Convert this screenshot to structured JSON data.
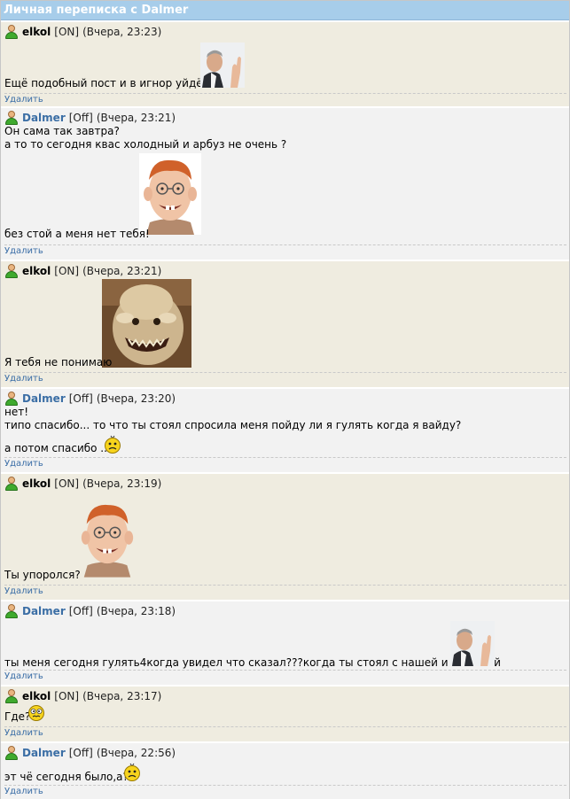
{
  "header": {
    "title": "Личная переписка с Dalmer"
  },
  "delete_label": "Удалить",
  "messages": [
    {
      "author": "elkol",
      "status": "[ON]",
      "time": "(Вчера, 23:23)",
      "lines": [
        "Ещё подобный пост и в игнор уйдёшь"
      ],
      "image": "politician-pointing-photo"
    },
    {
      "author": "Dalmer",
      "status": "[Off]",
      "time": "(Вчера, 23:21)",
      "lines": [
        "Он сама так завтра?",
        "а то то сегодня квас холодный и арбуз не очень ?",
        "без стой а меня нет тебя!"
      ],
      "image": "redhead-boy-caricature"
    },
    {
      "author": "elkol",
      "status": "[ON]",
      "time": "(Вчера, 23:21)",
      "lines": [
        "Я тебя не понимаю"
      ],
      "image": "furry-creature-photo"
    },
    {
      "author": "Dalmer",
      "status": "[Off]",
      "time": "(Вчера, 23:20)",
      "lines": [
        "нет!",
        "типо спасибо... то что ты стоял спросила меня пойду ли я гулять когда я вайду?",
        "а потом спасибо .."
      ],
      "image": "sad-smiley"
    },
    {
      "author": "elkol",
      "status": "[ON]",
      "time": "(Вчера, 23:19)",
      "lines": [
        "Ты упоролся?"
      ],
      "image": "redhead-boy-caricature"
    },
    {
      "author": "Dalmer",
      "status": "[Off]",
      "time": "(Вчера, 23:18)",
      "lines": [
        "ты меня сегодня гулять4когда увидел что сказал???когда ты стоял с нашей и снежной"
      ],
      "image": "politician-pointing-photo"
    },
    {
      "author": "elkol",
      "status": "[ON]",
      "time": "(Вчера, 23:17)",
      "lines": [
        "Где?"
      ],
      "image": "confused-smiley"
    },
    {
      "author": "Dalmer",
      "status": "[Off]",
      "time": "(Вчера, 22:56)",
      "lines": [
        "эт чё сегодня было,а?"
      ],
      "image": "sad-smiley"
    }
  ]
}
